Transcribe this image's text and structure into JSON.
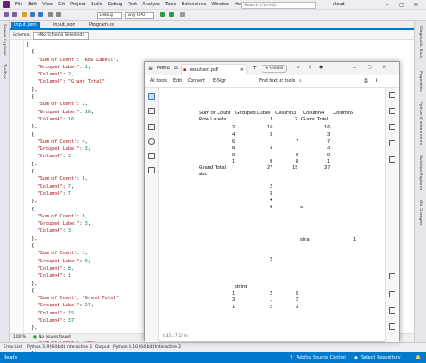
{
  "vs": {
    "menu": [
      "File",
      "Edit",
      "View",
      "Git",
      "Project",
      "Build",
      "Debug",
      "Test",
      "Analyze",
      "Tools",
      "Extensions",
      "Window",
      "Help"
    ],
    "search_placeholder": "Search (Ctrl+Q)",
    "solution_name": "cloud",
    "toolbar": {
      "config": "Debug",
      "platform": "Any CPU"
    },
    "left_panel": [
      "Server Explorer",
      "Toolbox"
    ],
    "right_panel": [
      "Diagnostic Tools",
      "Properties",
      "Python Environments",
      "Solution Explorer",
      "Git Changes"
    ],
    "tabs": [
      {
        "label": "input.json",
        "active": true
      },
      {
        "label": "input.json",
        "active": false
      },
      {
        "label": "Program.cs",
        "active": false
      }
    ],
    "schema_label": "Schema:",
    "schema_value": "<No Schema Selected>",
    "editor_status": {
      "zoom": "100 %",
      "issues": "No issues found"
    },
    "bottom_tabs": [
      "Error List",
      "Python 3.9 (64-bit) Interactive 1",
      "Output",
      "Python 3.10 (64-bit) Interactive 2"
    ],
    "statusbar": {
      "left": "Ready",
      "source_control": "Add to Source Control",
      "repo": "Select Repository"
    }
  },
  "code_lines": [
    [
      "[",
      ""
    ],
    [
      "  {",
      ""
    ],
    [
      "    \"Sum of Count\": \"Row Labels\",",
      ""
    ],
    [
      "    \"Grouped Label\": 1,",
      ""
    ],
    [
      "    \"Column3\": 2,",
      ""
    ],
    [
      "    \"Column4\": \"Grand Total\"",
      ""
    ],
    [
      "  },",
      ""
    ],
    [
      "  {",
      ""
    ],
    [
      "    \"Sum of Count\": 2,",
      ""
    ],
    [
      "    \"Grouped Label\": 16,",
      ""
    ],
    [
      "    \"Column4\": 16",
      ""
    ],
    [
      "  },",
      ""
    ],
    [
      "  {",
      ""
    ],
    [
      "    \"Sum of Count\": 4,",
      ""
    ],
    [
      "    \"Grouped Label\": 3,",
      ""
    ],
    [
      "    \"Column4\": 3",
      ""
    ],
    [
      "  },",
      ""
    ],
    [
      "  {",
      ""
    ],
    [
      "    \"Sum of Count\": 6,",
      ""
    ],
    [
      "    \"Column3\": 7,",
      ""
    ],
    [
      "    \"Column4\": 7",
      ""
    ],
    [
      "  },",
      ""
    ],
    [
      "  {",
      ""
    ],
    [
      "    \"Sum of Count\": 8,",
      ""
    ],
    [
      "    \"Grouped Label\": 3,",
      ""
    ],
    [
      "    \"Column4\": 3",
      ""
    ],
    [
      "  },",
      ""
    ],
    [
      "  {",
      ""
    ],
    [
      "    \"Sum of Count\": 1,",
      ""
    ],
    [
      "    \"Grouped Label\": 9,",
      ""
    ],
    [
      "    \"Column3\": 8,",
      ""
    ],
    [
      "    \"Column4\": 1",
      ""
    ],
    [
      "  },",
      ""
    ],
    [
      "  {",
      ""
    ],
    [
      "    \"Sum of Count\": \"Grand Total\",",
      ""
    ],
    [
      "    \"Grouped Label\": 27,",
      ""
    ],
    [
      "    \"Column3\": 15,",
      ""
    ],
    [
      "    \"Column4\": 37",
      ""
    ],
    [
      "  },",
      ""
    ],
    [
      "  {",
      ""
    ],
    [
      "    \"Sum of Count\": \"abc\"",
      ""
    ],
    [
      "  },",
      ""
    ],
    [
      "  null,",
      ""
    ],
    [
      "  {",
      ""
    ]
  ],
  "pdf": {
    "menu_label": "Menu",
    "tab_title": "resultant.pdf",
    "create_label": "Create",
    "toolbar": [
      "All tools",
      "Edit",
      "Convert",
      "E-Sign"
    ],
    "find_label": "Find text or tools",
    "page_size": "8.43 x 7.15 in",
    "table": {
      "header": [
        "Sum of Count",
        "Grouped Label",
        "Column3",
        "Column4",
        "Column6"
      ],
      "row_labels": [
        "Row Labels",
        "1",
        "2",
        "Grand Total"
      ],
      "r2": [
        "2",
        "16",
        "",
        "16"
      ],
      "r3": [
        "4",
        "3",
        "",
        "3"
      ],
      "r4": [
        "6",
        "",
        "7",
        "7"
      ],
      "r5": [
        "8",
        "3",
        "",
        "3"
      ],
      "r6": [
        "9",
        "",
        "0",
        "0"
      ],
      "r7": [
        "1",
        "9",
        "8",
        "1"
      ],
      "grand": [
        "Grand Total",
        "27",
        "15",
        "37"
      ],
      "abc": "abc",
      "b1": [
        "2",
        "3",
        "4",
        "9",
        "a"
      ],
      "sina": "sina",
      "sina_val": "1",
      "b2": "2",
      "string": "string",
      "s1": [
        "1",
        "2",
        "5"
      ],
      "s2": [
        "3",
        "1",
        "2"
      ],
      "s3": [
        "1",
        "2",
        "3"
      ]
    }
  }
}
